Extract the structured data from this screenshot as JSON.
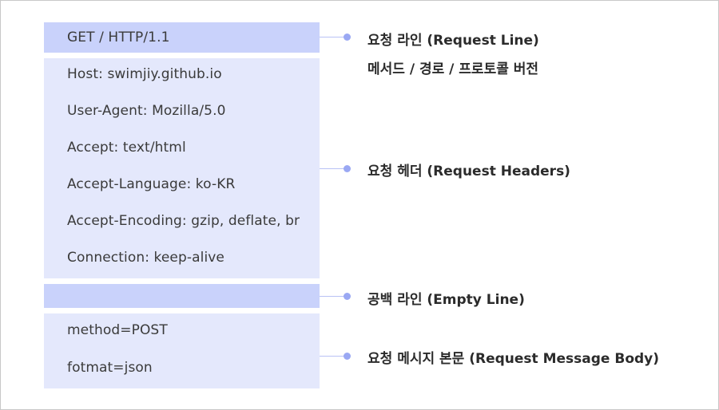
{
  "request_line": {
    "text": "GET / HTTP/1.1",
    "label": "요청 라인 (Request Line)",
    "sublabel": "메서드 / 경로 / 프로토콜 버전"
  },
  "headers": {
    "lines": [
      "Host: swimjiy.github.io",
      "User-Agent: Mozilla/5.0",
      "Accept: text/html",
      "Accept-Language: ko-KR",
      "Accept-Encoding: gzip, deflate, br",
      "Connection: keep-alive"
    ],
    "label": "요청 헤더 (Request Headers)"
  },
  "empty_line": {
    "label": "공백 라인 (Empty Line)"
  },
  "body": {
    "lines": [
      "method=POST",
      "fotmat=json"
    ],
    "label": "요청 메시지 본문 (Request Message Body)"
  },
  "colors": {
    "dark_block": "#c9d2fb",
    "light_block": "#e4e8fc",
    "connector": "#b9c2f5",
    "dot": "#9aa8f3"
  }
}
